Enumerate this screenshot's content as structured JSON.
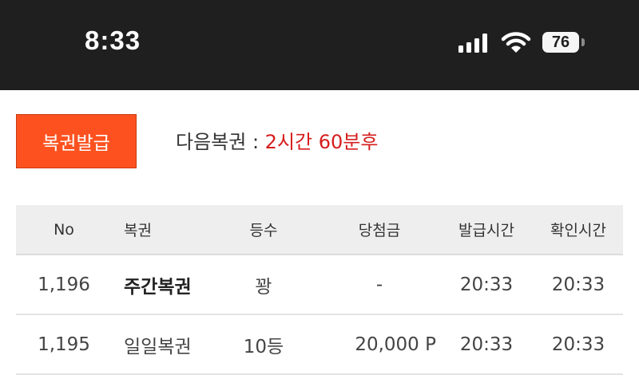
{
  "status_bar": {
    "time": "8:33",
    "battery": "76"
  },
  "issue_button": {
    "label": "복권발급"
  },
  "next_ticket": {
    "label": "다음복권 : ",
    "value": "2시간 60분후"
  },
  "table": {
    "headers": [
      "No",
      "복권",
      "등수",
      "당첨금",
      "발급시간",
      "확인시간"
    ],
    "rows": [
      {
        "no": "1,196",
        "ticket": "주간복권",
        "rank": "꽝",
        "prize": "-",
        "issued": "20:33",
        "checked": "20:33"
      },
      {
        "no": "1,195",
        "ticket": "일일복권",
        "rank": "10등",
        "prize": "20,000 P",
        "issued": "20:33",
        "checked": "20:33"
      }
    ]
  },
  "colors": {
    "accent": "#fd5220",
    "highlight": "#d61d1d",
    "status_bar": "#1f1f1f"
  }
}
